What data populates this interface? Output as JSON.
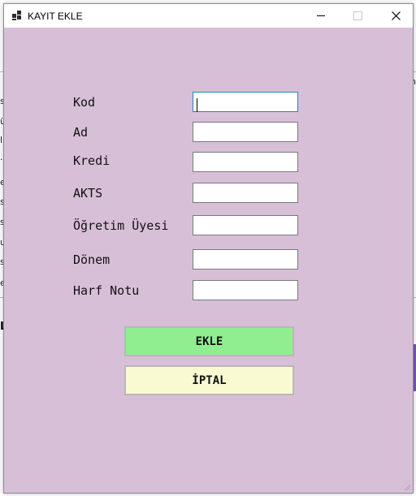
{
  "window": {
    "title": "KAYIT EKLE"
  },
  "window_controls": {
    "minimize": "minimize",
    "maximize": "maximize",
    "close": "close"
  },
  "form": {
    "fields": [
      {
        "label": "Kod",
        "value": ""
      },
      {
        "label": "Ad",
        "value": ""
      },
      {
        "label": "Kredi",
        "value": ""
      },
      {
        "label": "AKTS",
        "value": ""
      },
      {
        "label": "Öğretim Üyesi",
        "value": ""
      },
      {
        "label": "Dönem",
        "value": ""
      },
      {
        "label": "Harf Notu",
        "value": ""
      }
    ],
    "add_button": "EKLE",
    "cancel_button": "İPTAL"
  },
  "colors": {
    "dialog_background": "#d8bfd8",
    "add_button": "#90ee90",
    "cancel_button": "#fafad2"
  },
  "background_window": {
    "row_letters": [
      "s",
      "ü",
      "l",
      "·",
      "e",
      "s",
      "s",
      "u",
      "s",
      "e"
    ],
    "right_letters": [
      "n"
    ],
    "bold_letter": "L"
  }
}
